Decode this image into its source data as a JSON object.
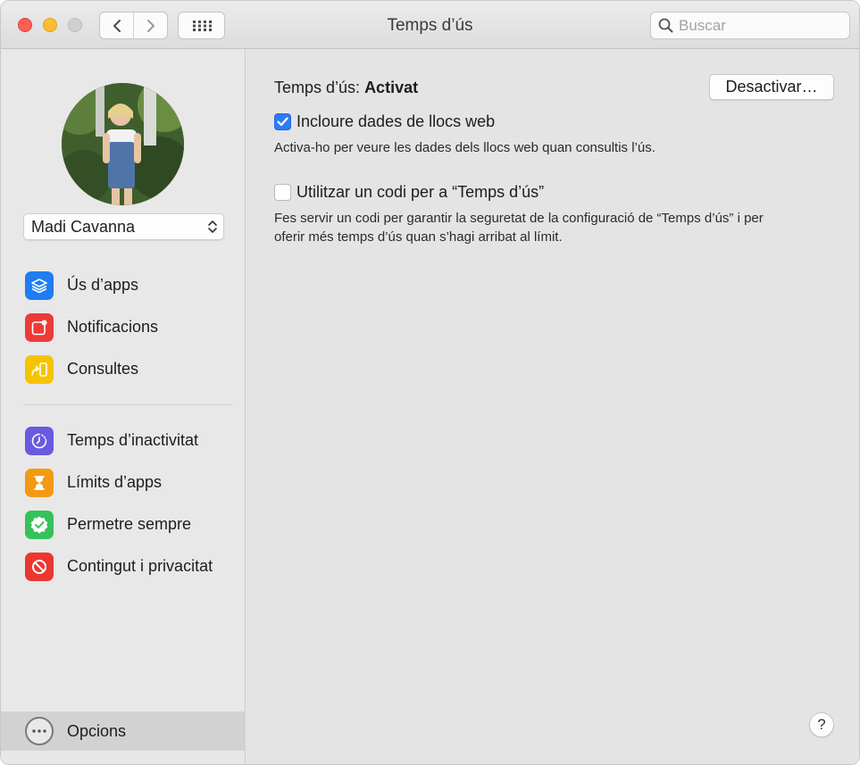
{
  "window": {
    "title": "Temps d’ús"
  },
  "search": {
    "placeholder": "Buscar",
    "value": ""
  },
  "sidebar": {
    "user": "Madi Cavanna",
    "groups": [
      [
        {
          "label": "Ús d’apps",
          "icon": "app-usage-icon",
          "color": "#1f7cf2"
        },
        {
          "label": "Notificacions",
          "icon": "notifications-icon",
          "color": "#ee3b37"
        },
        {
          "label": "Consultes",
          "icon": "pickups-icon",
          "color": "#f5c400"
        }
      ],
      [
        {
          "label": "Temps d’inactivitat",
          "icon": "downtime-icon",
          "color": "#6a5ae0"
        },
        {
          "label": "Límits d’apps",
          "icon": "app-limits-icon",
          "color": "#f39a12"
        },
        {
          "label": "Permetre sempre",
          "icon": "always-allowed-icon",
          "color": "#36c25a"
        },
        {
          "label": "Contingut i privacitat",
          "icon": "content-privacy-icon",
          "color": "#ec3730"
        }
      ]
    ],
    "options_label": "Opcions"
  },
  "main": {
    "status_prefix": "Temps d’ús:",
    "status_value": "Activat",
    "deactivate_button": "Desactivar…",
    "website_data": {
      "label": "Incloure dades de llocs web",
      "checked": true,
      "description": "Activa-ho per veure les dades dels llocs web quan consultis l’ús."
    },
    "passcode": {
      "label": "Utilitzar un codi per a “Temps d’ús”",
      "checked": false,
      "description_line1": "Fes servir un codi per garantir la seguretat de la configuració de “Temps d’ús” i per",
      "description_line2": "oferir més temps d’ús quan s’hagi arribat al límit."
    },
    "help_label": "?"
  }
}
